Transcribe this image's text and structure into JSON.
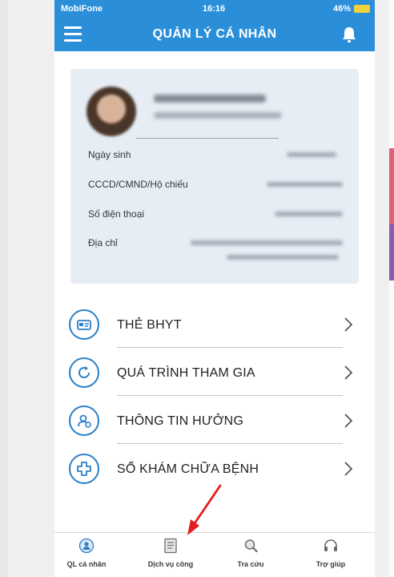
{
  "status_bar": {
    "carrier": "MobiFone",
    "time": "16:16",
    "battery": "46%"
  },
  "header": {
    "title": "QUẢN LÝ CÁ NHÂN"
  },
  "profile": {
    "fields": [
      {
        "label": "Ngày sinh"
      },
      {
        "label": "CCCD/CMND/Hộ chiếu"
      },
      {
        "label": "Số điện thoại"
      },
      {
        "label": "Địa chỉ"
      }
    ]
  },
  "menu": {
    "items": [
      {
        "label": "THẺ BHYT",
        "icon": "card-icon"
      },
      {
        "label": "QUÁ TRÌNH THAM GIA",
        "icon": "refresh-icon"
      },
      {
        "label": "THÔNG TIN HƯỞNG",
        "icon": "user-info-icon"
      },
      {
        "label": "SỔ KHÁM CHỮA BỆNH",
        "icon": "medical-cross-icon"
      }
    ]
  },
  "tabs": [
    {
      "label": "QL cá nhân",
      "icon": "profile-tab-icon"
    },
    {
      "label": "Dịch vụ công",
      "icon": "document-tab-icon"
    },
    {
      "label": "Tra cứu",
      "icon": "search-tab-icon"
    },
    {
      "label": "Trợ giúp",
      "icon": "headset-tab-icon"
    }
  ],
  "colors": {
    "accent": "#2a8fd8",
    "icon_outline": "#2a7fc8",
    "card_bg": "#e6edf4",
    "arrow": "#e02020"
  }
}
